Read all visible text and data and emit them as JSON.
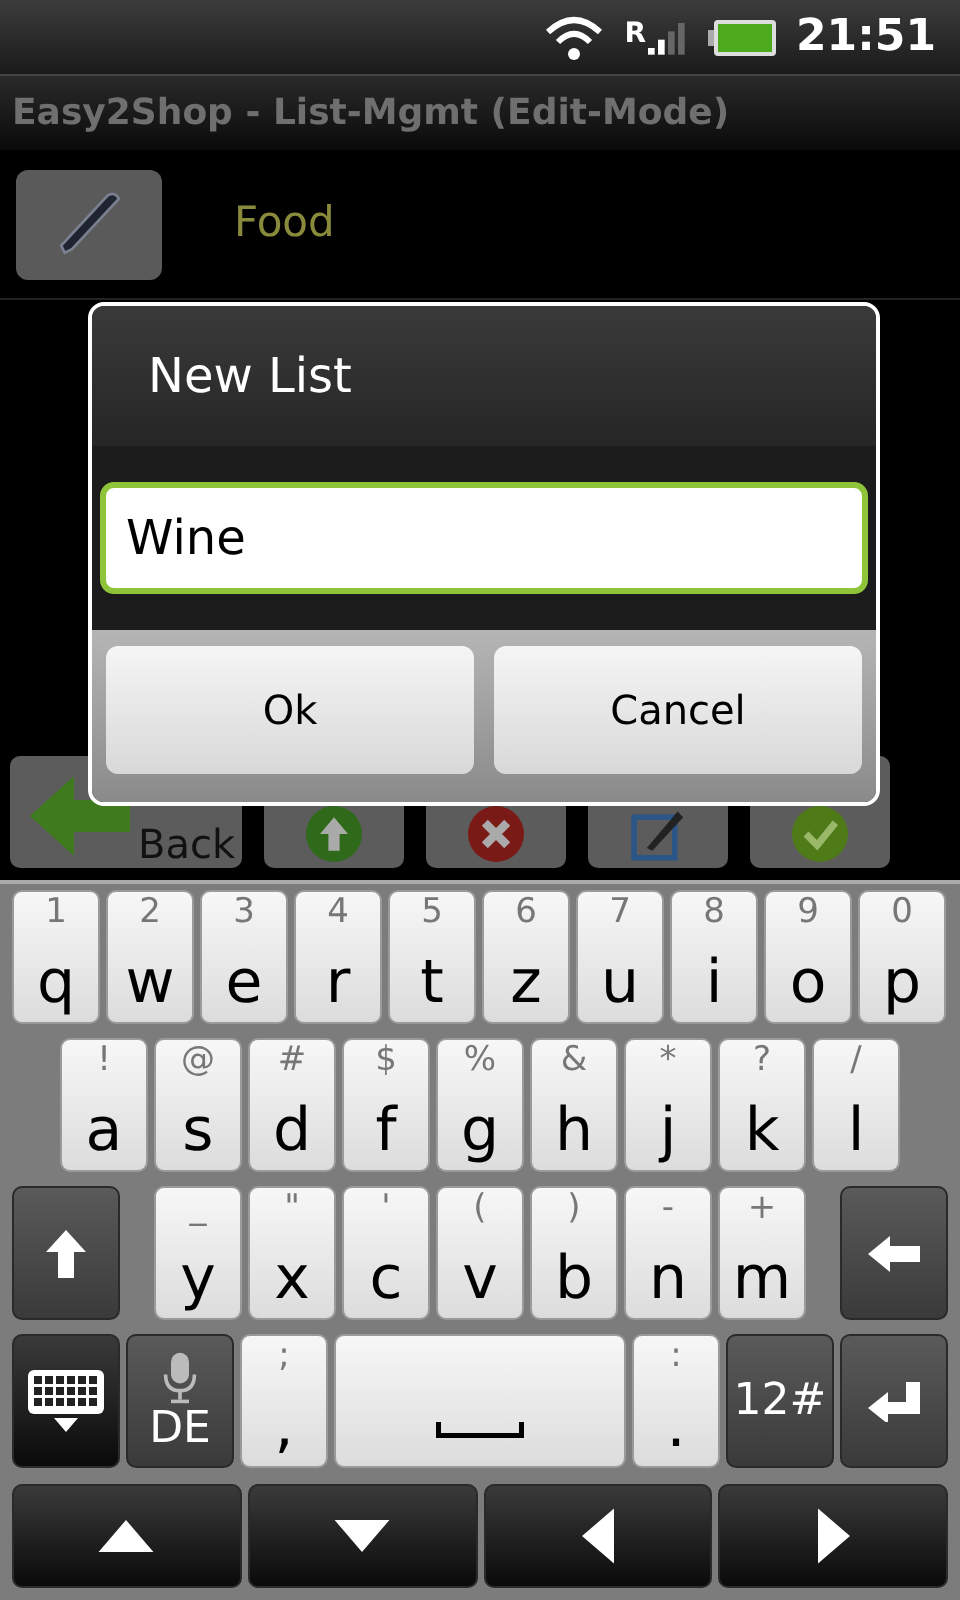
{
  "status_bar": {
    "network_letter": "R",
    "time": "21:51"
  },
  "title": "Easy2Shop - List-Mgmt (Edit-Mode)",
  "lists": [
    {
      "name": "Food"
    }
  ],
  "toolbar": {
    "back_label": "Back"
  },
  "dialog": {
    "title": "New List",
    "input": {
      "value": "Wine"
    },
    "buttons": [
      "Ok",
      "Cancel"
    ]
  },
  "keyboard": {
    "rows": [
      {
        "keys": [
          {
            "kind": "letter",
            "alt": "1",
            "main": "q"
          },
          {
            "kind": "letter",
            "alt": "2",
            "main": "w"
          },
          {
            "kind": "letter",
            "alt": "3",
            "main": "e"
          },
          {
            "kind": "letter",
            "alt": "4",
            "main": "r"
          },
          {
            "kind": "letter",
            "alt": "5",
            "main": "t"
          },
          {
            "kind": "letter",
            "alt": "6",
            "main": "z"
          },
          {
            "kind": "letter",
            "alt": "7",
            "main": "u"
          },
          {
            "kind": "letter",
            "alt": "8",
            "main": "i"
          },
          {
            "kind": "letter",
            "alt": "9",
            "main": "o"
          },
          {
            "kind": "letter",
            "alt": "0",
            "main": "p"
          }
        ]
      },
      {
        "keys": [
          {
            "kind": "letter",
            "alt": "!",
            "main": "a"
          },
          {
            "kind": "letter",
            "alt": "@",
            "main": "s"
          },
          {
            "kind": "letter",
            "alt": "#",
            "main": "d"
          },
          {
            "kind": "letter",
            "alt": "$",
            "main": "f"
          },
          {
            "kind": "letter",
            "alt": "%",
            "main": "g"
          },
          {
            "kind": "letter",
            "alt": "&",
            "main": "h"
          },
          {
            "kind": "letter",
            "alt": "*",
            "main": "j"
          },
          {
            "kind": "letter",
            "alt": "?",
            "main": "k"
          },
          {
            "kind": "letter",
            "alt": "/",
            "main": "l"
          }
        ]
      },
      {
        "keys": [
          {
            "kind": "shift"
          },
          {
            "kind": "letter",
            "alt": "_",
            "main": "y"
          },
          {
            "kind": "letter",
            "alt": "\"",
            "main": "x"
          },
          {
            "kind": "letter",
            "alt": "'",
            "main": "c"
          },
          {
            "kind": "letter",
            "alt": "(",
            "main": "v"
          },
          {
            "kind": "letter",
            "alt": ")",
            "main": "b"
          },
          {
            "kind": "letter",
            "alt": "-",
            "main": "n"
          },
          {
            "kind": "letter",
            "alt": "+",
            "main": "m"
          },
          {
            "kind": "backspace"
          }
        ]
      },
      {
        "keys": [
          {
            "kind": "hide"
          },
          {
            "kind": "voice",
            "label": "DE"
          },
          {
            "kind": "symbol",
            "alt": ";",
            "main": ","
          },
          {
            "kind": "space"
          },
          {
            "kind": "symbol",
            "alt": ":",
            "main": "."
          },
          {
            "kind": "mode",
            "label": "12#"
          },
          {
            "kind": "enter"
          }
        ]
      },
      {
        "keys": [
          {
            "kind": "up"
          },
          {
            "kind": "down"
          },
          {
            "kind": "left"
          },
          {
            "kind": "right"
          }
        ]
      }
    ]
  }
}
